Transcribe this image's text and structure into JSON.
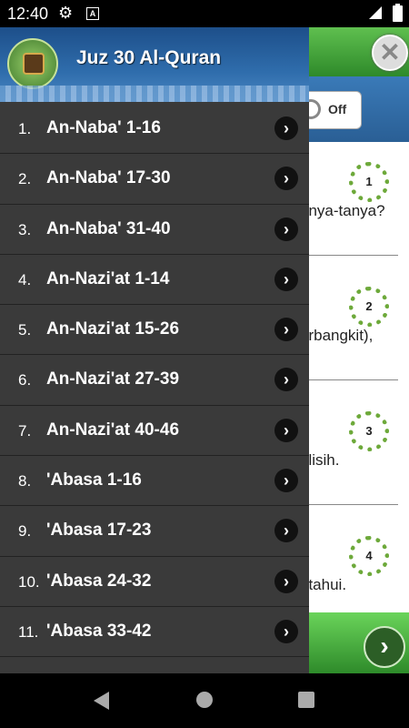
{
  "status_bar": {
    "time": "12:40",
    "icons": [
      "gear-icon",
      "a-box-icon",
      "signal-icon",
      "battery-charging-icon"
    ]
  },
  "app": {
    "title": "Juz 30 Al-Quran",
    "toggle_label": "Off",
    "verses": [
      {
        "number": "1",
        "text": "anya-tanya?"
      },
      {
        "number": "2",
        "text": "erbangkit),"
      },
      {
        "number": "3",
        "text": "elisih."
      },
      {
        "number": "4",
        "text": "etahui."
      }
    ],
    "close_icon": "close-icon",
    "next_icon": "chevron-right-icon"
  },
  "drawer": {
    "items": [
      {
        "number": "1.",
        "label": "An-Naba' 1-16"
      },
      {
        "number": "2.",
        "label": "An-Naba' 17-30"
      },
      {
        "number": "3.",
        "label": "An-Naba' 31-40"
      },
      {
        "number": "4.",
        "label": "An-Nazi'at 1-14"
      },
      {
        "number": "5.",
        "label": "An-Nazi'at 15-26"
      },
      {
        "number": "6.",
        "label": "An-Nazi'at 27-39"
      },
      {
        "number": "7.",
        "label": "An-Nazi'at 40-46"
      },
      {
        "number": "8.",
        "label": "'Abasa 1-16"
      },
      {
        "number": "9.",
        "label": "'Abasa 17-23"
      },
      {
        "number": "10.",
        "label": "'Abasa 24-32"
      },
      {
        "number": "11.",
        "label": "'Abasa 33-42"
      }
    ]
  }
}
